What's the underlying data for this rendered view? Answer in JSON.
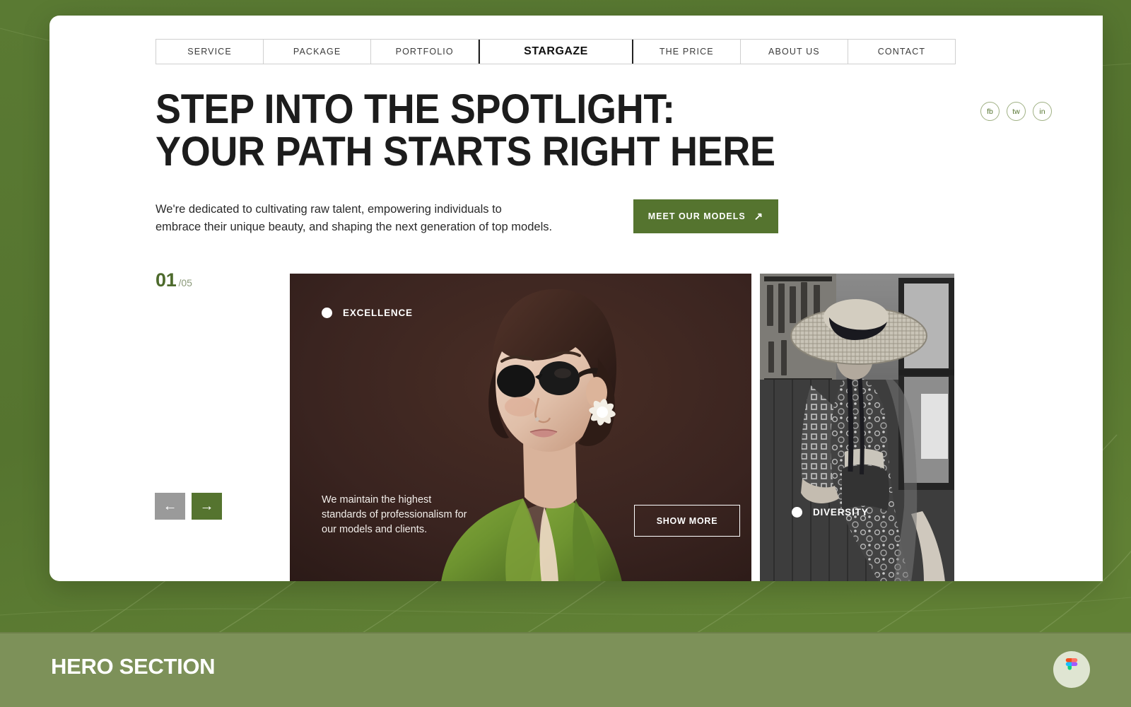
{
  "theme": {
    "brand_green": "#55742f",
    "bar_green": "#7d9159",
    "card_brown": "#3a2520",
    "grey": "#9a9a9a"
  },
  "nav": {
    "items": [
      {
        "label": "SERVICE",
        "active": false
      },
      {
        "label": "PACKAGE",
        "active": false
      },
      {
        "label": "PORTFOLIO",
        "active": false
      },
      {
        "label": "STARGAZE",
        "active": true
      },
      {
        "label": "THE PRICE",
        "active": false
      },
      {
        "label": "ABOUT US",
        "active": false
      },
      {
        "label": "CONTACT",
        "active": false
      }
    ]
  },
  "hero": {
    "headline": "STEP INTO THE SPOTLIGHT:\nYOUR PATH STARTS RIGHT HERE",
    "lead": "We're dedicated to cultivating raw talent, empowering individuals to\nembrace their unique beauty, and shaping the next generation of top models.",
    "cta_label": "MEET OUR MODELS",
    "cta_arrow": "↗"
  },
  "socials": [
    {
      "label": "fb",
      "name": "facebook"
    },
    {
      "label": "tw",
      "name": "twitter"
    },
    {
      "label": "in",
      "name": "instagram"
    }
  ],
  "slider": {
    "current": "01",
    "total": "/05",
    "prev_arrow": "←",
    "next_arrow": "→"
  },
  "cards": {
    "main": {
      "tag": "EXCELLENCE",
      "description": "We maintain the highest\nstandards of professionalism for\nour models and clients.",
      "button_label": "SHOW MORE"
    },
    "side": {
      "tag": "DIVERSITY"
    }
  },
  "footer": {
    "title": "HERO SECTION",
    "badge_icon": "figma-icon"
  }
}
